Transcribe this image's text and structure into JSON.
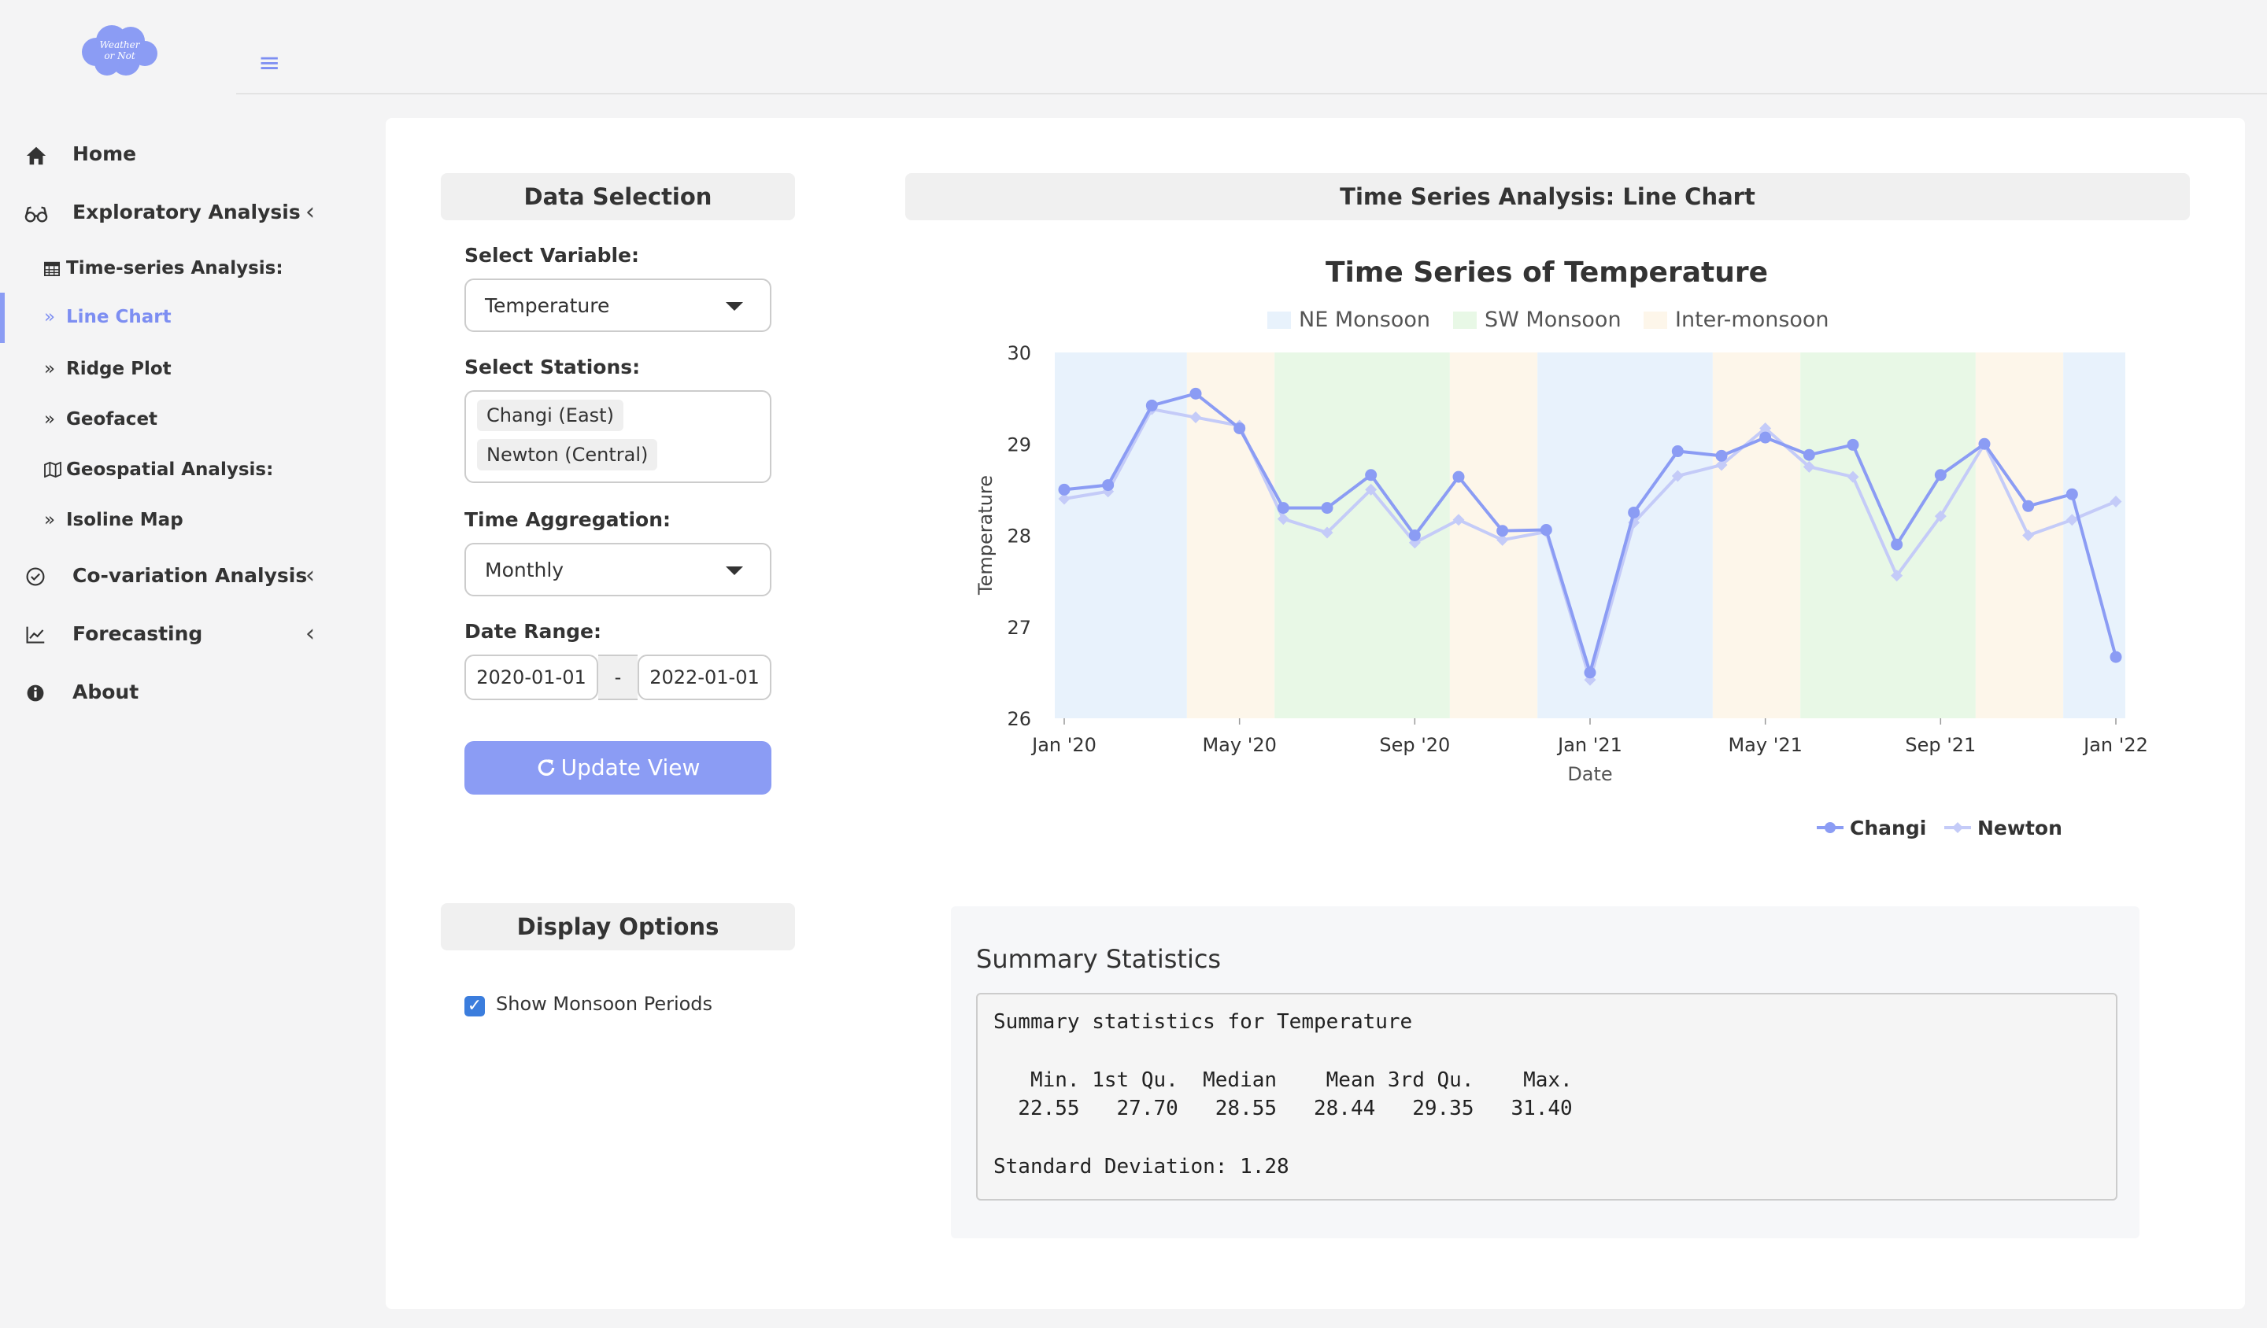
{
  "app": {
    "logo_text_line1": "Weather",
    "logo_text_line2": "or Not",
    "menu_icon": "hamburger-icon"
  },
  "sidebar": {
    "items": [
      {
        "label": "Home",
        "icon": "home-icon"
      },
      {
        "label": "Exploratory Analysis",
        "icon": "glasses-icon"
      },
      {
        "label": "Co-variation Analysis",
        "icon": "check-circle-icon"
      },
      {
        "label": "Forecasting",
        "icon": "chart-line-icon"
      },
      {
        "label": "About",
        "icon": "info-icon"
      }
    ],
    "subitems": [
      {
        "label": "Time-series Analysis:",
        "icon": "calendar-icon"
      },
      {
        "label": "Line Chart",
        "icon": "double-chevron-icon"
      },
      {
        "label": "Ridge Plot",
        "icon": "double-chevron-icon"
      },
      {
        "label": "Geofacet",
        "icon": "double-chevron-icon"
      },
      {
        "label": "Geospatial Analysis:",
        "icon": "map-icon"
      },
      {
        "label": "Isoline Map",
        "icon": "double-chevron-icon"
      }
    ]
  },
  "data_selection": {
    "header": "Data Selection",
    "variable_label": "Select Variable:",
    "variable_value": "Temperature",
    "stations_label": "Select Stations:",
    "stations": [
      "Changi (East)",
      "Newton (Central)"
    ],
    "aggregation_label": "Time Aggregation:",
    "aggregation_value": "Monthly",
    "date_range_label": "Date Range:",
    "date_start": "2020-01-01",
    "date_sep": "-",
    "date_end": "2022-01-01",
    "update_button": "Update View"
  },
  "display_options": {
    "header": "Display Options",
    "show_monsoon_label": "Show Monsoon Periods",
    "show_monsoon_checked": true
  },
  "chart_panel": {
    "header": "Time Series Analysis: Line Chart"
  },
  "chart_data": {
    "type": "line",
    "title": "Time Series of Temperature",
    "xlabel": "Date",
    "ylabel": "Temperature",
    "ylim": [
      26,
      30
    ],
    "yticks": [
      "26",
      "27",
      "28",
      "29",
      "30"
    ],
    "xticks": [
      "Jan '20",
      "May '20",
      "Sep '20",
      "Jan '21",
      "May '21",
      "Sep '21",
      "Jan '22"
    ],
    "x": [
      "2020-01",
      "2020-02",
      "2020-03",
      "2020-04",
      "2020-05",
      "2020-06",
      "2020-07",
      "2020-08",
      "2020-09",
      "2020-10",
      "2020-11",
      "2020-12",
      "2021-01",
      "2021-02",
      "2021-03",
      "2021-04",
      "2021-05",
      "2021-06",
      "2021-07",
      "2021-08",
      "2021-09",
      "2021-10",
      "2021-11",
      "2021-12",
      "2022-01"
    ],
    "series": [
      {
        "name": "Changi",
        "color": "#8b9cf4",
        "marker": "circle",
        "values": [
          28.5,
          28.55,
          29.42,
          29.55,
          29.17,
          28.3,
          28.3,
          28.66,
          28.0,
          28.64,
          28.05,
          28.06,
          26.5,
          28.25,
          28.92,
          28.87,
          29.07,
          28.88,
          28.99,
          27.9,
          28.66,
          29.0,
          28.32,
          28.45,
          26.67
        ]
      },
      {
        "name": "Newton",
        "color": "#c4cbf8",
        "marker": "diamond",
        "values": [
          28.4,
          28.48,
          29.38,
          29.29,
          29.2,
          28.18,
          28.03,
          28.5,
          27.92,
          28.17,
          27.95,
          28.04,
          26.42,
          28.14,
          28.65,
          28.77,
          29.17,
          28.75,
          28.64,
          27.56,
          28.21,
          29.0,
          28.0,
          28.17,
          28.37
        ]
      }
    ],
    "bands": [
      {
        "name": "NE Monsoon",
        "color": "#e8f2fc"
      },
      {
        "name": "SW Monsoon",
        "color": "#e8f8e6"
      },
      {
        "name": "Inter-monsoon",
        "color": "#fdf6ea"
      }
    ],
    "band_periods": [
      {
        "band": 0,
        "from": "2020-01",
        "to": "2020-04"
      },
      {
        "band": 2,
        "from": "2020-04",
        "to": "2020-06"
      },
      {
        "band": 1,
        "from": "2020-06",
        "to": "2020-10"
      },
      {
        "band": 2,
        "from": "2020-10",
        "to": "2020-12"
      },
      {
        "band": 0,
        "from": "2020-12",
        "to": "2021-04"
      },
      {
        "band": 2,
        "from": "2021-04",
        "to": "2021-06"
      },
      {
        "band": 1,
        "from": "2021-06",
        "to": "2021-10"
      },
      {
        "band": 2,
        "from": "2021-10",
        "to": "2021-12"
      },
      {
        "band": 0,
        "from": "2021-12",
        "to": "2022-01"
      }
    ],
    "legend": "bottom"
  },
  "summary": {
    "title": "Summary Statistics",
    "line1": "Summary statistics for Temperature",
    "header_row": "   Min. 1st Qu.  Median    Mean 3rd Qu.    Max.",
    "value_row": "  22.55   27.70   28.55   28.44   29.35   31.40",
    "sd_line": "Standard Deviation: 1.28"
  }
}
